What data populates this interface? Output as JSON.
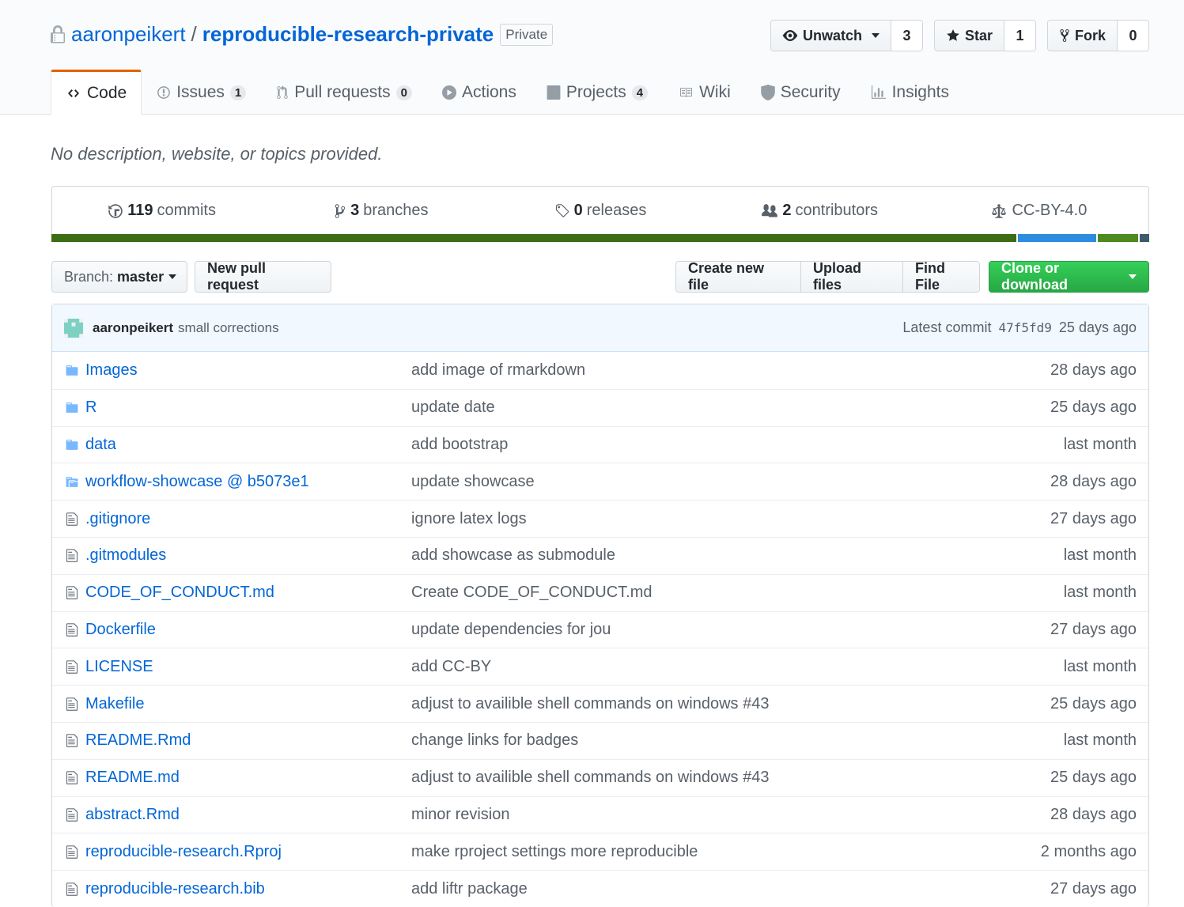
{
  "repo": {
    "owner": "aaronpeikert",
    "separator": "/",
    "name": "reproducible-research-private",
    "visibility": "Private"
  },
  "actions": {
    "watch": {
      "label": "Unwatch",
      "count": "3"
    },
    "star": {
      "label": "Star",
      "count": "1"
    },
    "fork": {
      "label": "Fork",
      "count": "0"
    }
  },
  "tabs": [
    {
      "label": "Code",
      "counter": null,
      "icon": "code-icon"
    },
    {
      "label": "Issues",
      "counter": "1",
      "icon": "issue-icon"
    },
    {
      "label": "Pull requests",
      "counter": "0",
      "icon": "pull-request-icon"
    },
    {
      "label": "Actions",
      "counter": null,
      "icon": "play-icon"
    },
    {
      "label": "Projects",
      "counter": "4",
      "icon": "project-icon"
    },
    {
      "label": "Wiki",
      "counter": null,
      "icon": "book-icon"
    },
    {
      "label": "Security",
      "counter": null,
      "icon": "shield-icon"
    },
    {
      "label": "Insights",
      "counter": null,
      "icon": "graph-icon"
    }
  ],
  "description": "No description, website, or topics provided.",
  "summary": {
    "commits": {
      "count": "119",
      "label": "commits"
    },
    "branches": {
      "count": "3",
      "label": "branches"
    },
    "releases": {
      "count": "0",
      "label": "releases"
    },
    "contributors": {
      "count": "2",
      "label": "contributors"
    },
    "license": "CC-BY-4.0"
  },
  "language_bar": [
    {
      "color": "#3c6c14",
      "fraction": 0.879
    },
    {
      "color": "#2b8ce0",
      "fraction": 0.073
    },
    {
      "color": "#4e8b1f",
      "fraction": 0.038
    },
    {
      "color": "#3d5a6b",
      "fraction": 0.01
    }
  ],
  "file_nav": {
    "branch_prefix": "Branch:",
    "branch": "master",
    "new_pull_request": "New pull request",
    "create_new_file": "Create new file",
    "upload_files": "Upload files",
    "find_file": "Find File",
    "clone_or_download": "Clone or download"
  },
  "latest_commit": {
    "author": "aaronpeikert",
    "message": "small corrections",
    "prefix": "Latest commit",
    "sha": "47f5fd9",
    "age": "25 days ago"
  },
  "files": [
    {
      "type": "dir",
      "name": "Images",
      "message": "add image of rmarkdown",
      "age": "28 days ago"
    },
    {
      "type": "dir",
      "name": "R",
      "message": "update date",
      "age": "25 days ago"
    },
    {
      "type": "dir",
      "name": "data",
      "message": "add bootstrap",
      "age": "last month"
    },
    {
      "type": "submodule",
      "name": "workflow-showcase @ b5073e1",
      "message": "update showcase",
      "age": "28 days ago"
    },
    {
      "type": "file",
      "name": ".gitignore",
      "message": "ignore latex logs",
      "age": "27 days ago"
    },
    {
      "type": "file",
      "name": ".gitmodules",
      "message": "add showcase as submodule",
      "age": "last month"
    },
    {
      "type": "file",
      "name": "CODE_OF_CONDUCT.md",
      "message": "Create CODE_OF_CONDUCT.md",
      "age": "last month"
    },
    {
      "type": "file",
      "name": "Dockerfile",
      "message": "update dependencies for jou",
      "age": "27 days ago"
    },
    {
      "type": "file",
      "name": "LICENSE",
      "message": "add CC-BY",
      "age": "last month"
    },
    {
      "type": "file",
      "name": "Makefile",
      "message": "adjust to availible shell commands on windows #43",
      "age": "25 days ago"
    },
    {
      "type": "file",
      "name": "README.Rmd",
      "message": "change links for badges",
      "age": "last month"
    },
    {
      "type": "file",
      "name": "README.md",
      "message": "adjust to availible shell commands on windows #43",
      "age": "25 days ago"
    },
    {
      "type": "file",
      "name": "abstract.Rmd",
      "message": "minor revision",
      "age": "28 days ago"
    },
    {
      "type": "file",
      "name": "reproducible-research.Rproj",
      "message": "make rproject settings more reproducible",
      "age": "2 months ago"
    },
    {
      "type": "file",
      "name": "reproducible-research.bib",
      "message": "add liftr package",
      "age": "27 days ago"
    }
  ]
}
